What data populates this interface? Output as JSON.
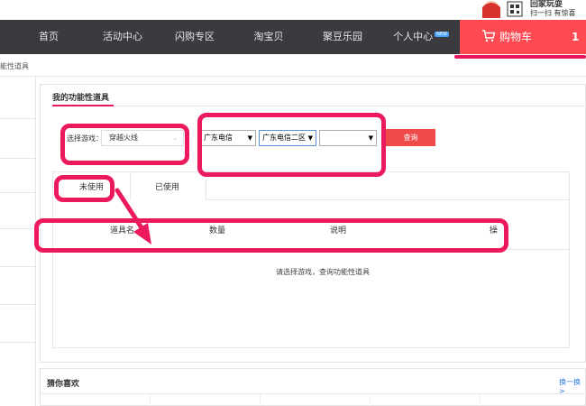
{
  "header": {
    "qr_title": "回家玩耍",
    "qr_caption": "扫一扫 有惊喜"
  },
  "nav": {
    "items": [
      {
        "label": "首页"
      },
      {
        "label": "活动中心"
      },
      {
        "label": "闪购专区"
      },
      {
        "label": "淘宝贝"
      },
      {
        "label": "聚豆乐园"
      },
      {
        "label": "个人中心",
        "badge": "NEW"
      }
    ],
    "cart_label": "购物车",
    "cart_count": "1"
  },
  "breadcrumb": "能性道具",
  "panel": {
    "title": "我的功能性道具",
    "game_label": "选择游戏：",
    "game_value": "穿越火线",
    "selects": [
      {
        "value": "广东电信"
      },
      {
        "value": "广东电信二区"
      },
      {
        "value": ""
      }
    ],
    "query_label": "查询",
    "tabs": [
      {
        "label": "未使用"
      },
      {
        "label": "已使用"
      }
    ],
    "columns": [
      "道具名",
      "数量",
      "说明",
      "操"
    ],
    "empty_message": "请选择游戏，查询功能性道具"
  },
  "guess": {
    "title": "猜你喜欢",
    "more": "换一换>"
  },
  "colors": {
    "nav_bg": "#3a3a3f",
    "cart_bg": "#ff4a52",
    "accent": "#ec1a5c",
    "query_bg": "#ef4a4a",
    "link": "#2a7ad8"
  }
}
